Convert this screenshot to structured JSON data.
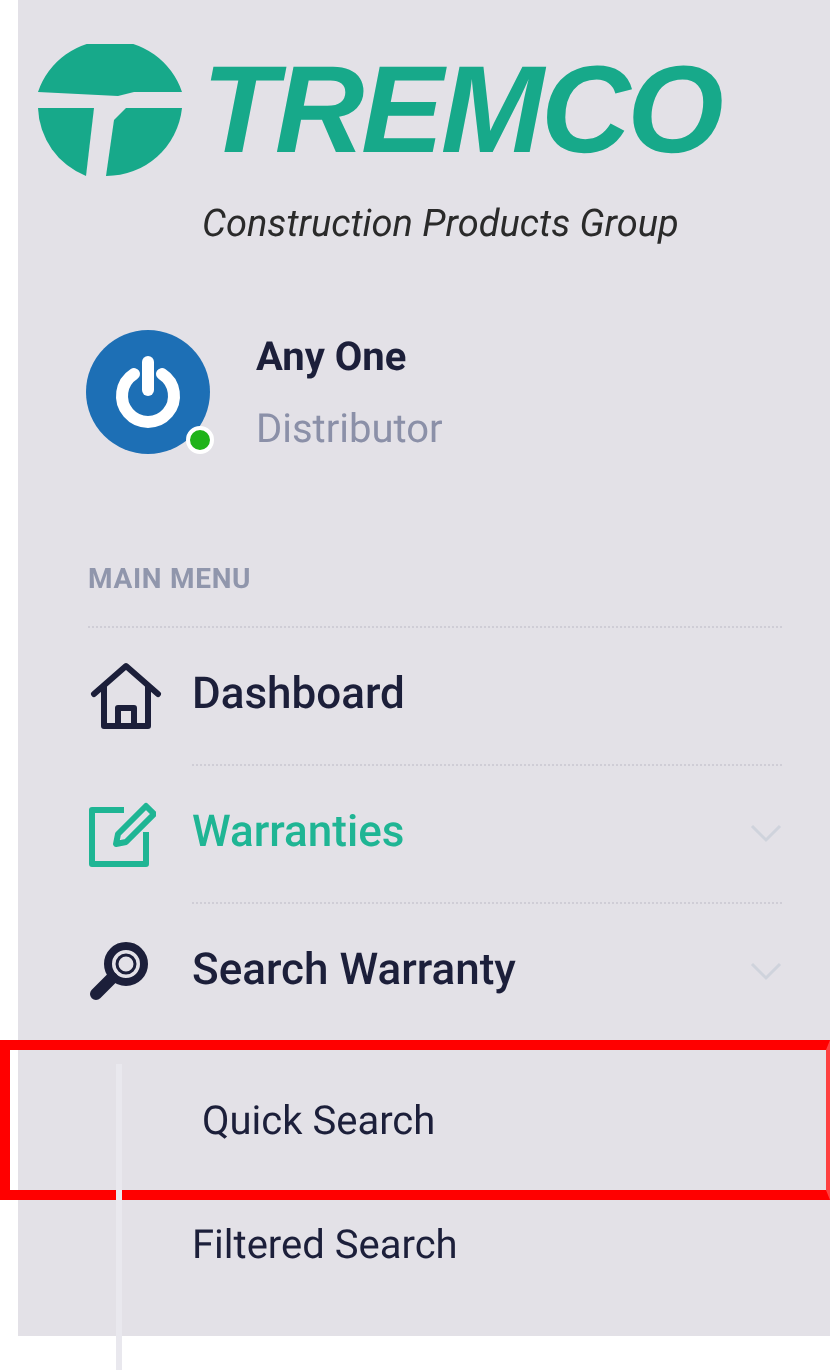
{
  "logo": {
    "wordmark": "TREMCO",
    "tagline": "Construction Products Group"
  },
  "user": {
    "name": "Any One",
    "role": "Distributor",
    "online": true
  },
  "menu": {
    "heading": "MAIN MENU",
    "items": [
      {
        "label": "Dashboard",
        "kind": "home",
        "selected": false
      },
      {
        "label": "Warranties",
        "kind": "edit",
        "selected": true,
        "expandable": true
      },
      {
        "label": "Search Warranty",
        "kind": "search",
        "selected": false,
        "expandable": true,
        "children": [
          {
            "label": "Quick Search",
            "highlighted": true
          },
          {
            "label": "Filtered Search",
            "highlighted": false
          }
        ]
      }
    ]
  }
}
